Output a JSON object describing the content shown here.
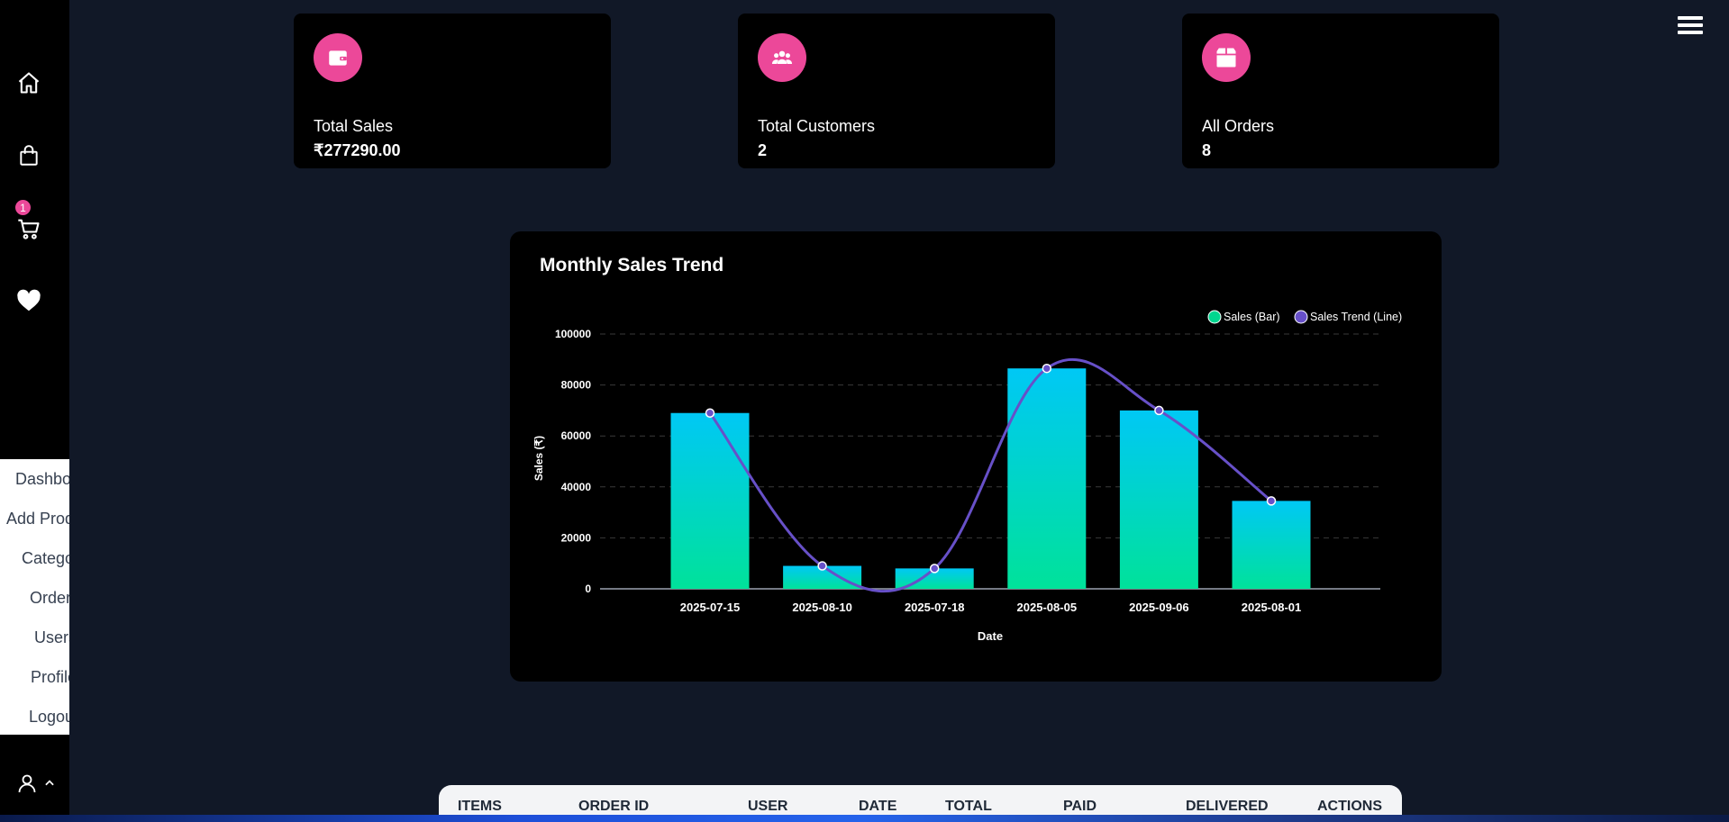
{
  "sidebar": {
    "icons": [
      "home-icon",
      "shopping-bag-icon",
      "cart-icon",
      "heart-icon"
    ],
    "cart_count": "1",
    "menu": [
      "Dashboard",
      "Add Product",
      "Category",
      "Orders",
      "Users",
      "Profile",
      "Logout"
    ]
  },
  "cards": [
    {
      "label": "Total Sales",
      "value": "₹277290.00",
      "icon": "wallet-icon"
    },
    {
      "label": "Total Customers",
      "value": "2",
      "icon": "users-icon"
    },
    {
      "label": "All Orders",
      "value": "8",
      "icon": "box-icon"
    }
  ],
  "colors": {
    "accent": "#ec4899",
    "bar_top": "#00c8f5",
    "bar_bottom": "#00e29a",
    "line": "#6750c8"
  },
  "chart_data": {
    "type": "bar",
    "title": "Monthly Sales Trend",
    "xlabel": "Date",
    "ylabel": "Sales (₹)",
    "categories": [
      "2025-07-15",
      "2025-08-10",
      "2025-07-18",
      "2025-08-05",
      "2025-09-06",
      "2025-08-01"
    ],
    "series": [
      {
        "name": "Sales (Bar)",
        "type": "bar",
        "values": [
          69000,
          9000,
          8000,
          86500,
          70000,
          34500
        ]
      },
      {
        "name": "Sales Trend (Line)",
        "type": "line",
        "values": [
          69000,
          9000,
          8000,
          86500,
          70000,
          34500
        ]
      }
    ],
    "ylim": [
      0,
      100000
    ],
    "yticks": [
      "0",
      "20000",
      "40000",
      "60000",
      "80000",
      "100000"
    ],
    "grid": true,
    "legend": "top-right"
  },
  "table": {
    "headers": [
      "ITEMS",
      "ORDER ID",
      "USER",
      "DATE",
      "TOTAL",
      "PAID",
      "DELIVERED",
      "ACTIONS"
    ]
  }
}
